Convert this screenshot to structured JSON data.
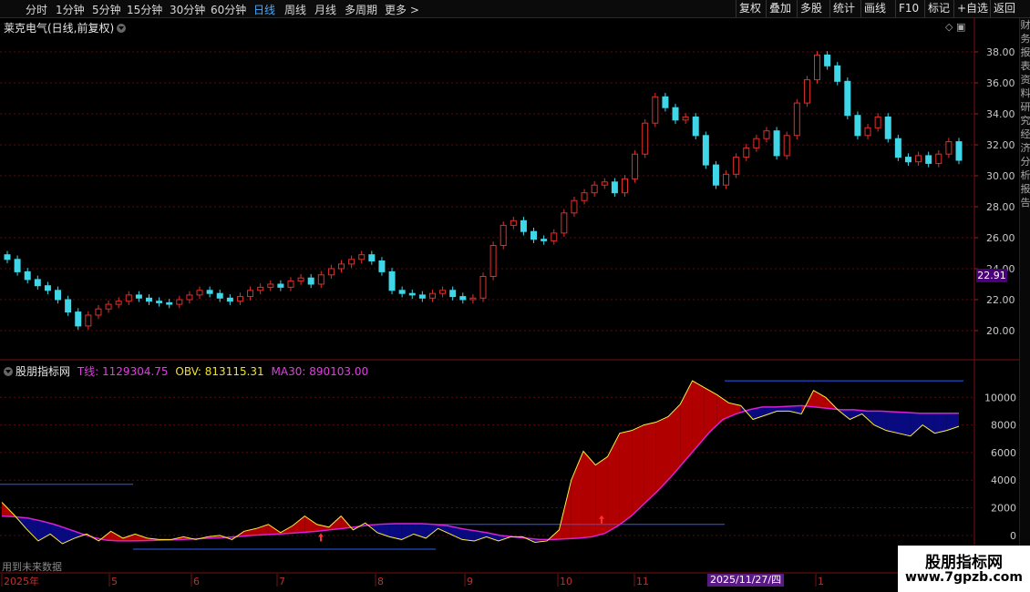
{
  "toolbar": {
    "timeframes": [
      {
        "label": "分时",
        "active": false
      },
      {
        "label": "1分钟",
        "active": false
      },
      {
        "label": "5分钟",
        "active": false
      },
      {
        "label": "15分钟",
        "active": false
      },
      {
        "label": "30分钟",
        "active": false
      },
      {
        "label": "60分钟",
        "active": false
      },
      {
        "label": "日线",
        "active": true
      },
      {
        "label": "周线",
        "active": false
      },
      {
        "label": "月线",
        "active": false
      },
      {
        "label": "多周期",
        "active": false
      },
      {
        "label": "更多 >",
        "active": false
      }
    ],
    "buttons": [
      "复权",
      "叠加",
      "多股",
      "统计",
      "画线",
      "F10",
      "标记",
      "+自选",
      "返回"
    ]
  },
  "main_title": "莱克电气(日线,前复权)",
  "price_axis": [
    "38.00",
    "36.00",
    "34.00",
    "32.00",
    "30.00",
    "28.00",
    "26.00",
    "24.00",
    "22.00",
    "20.00"
  ],
  "current_price": "22.91",
  "indicator": {
    "name": "股朋指标网",
    "t_label": "T线: 1129304.75",
    "obv_label": "OBV: 813115.31",
    "ma_label": "MA30: 890103.00",
    "axis": [
      "10000",
      "8000",
      "6000",
      "4000",
      "2000",
      "0"
    ]
  },
  "time_axis": [
    "2025年",
    "5",
    "6",
    "7",
    "8",
    "9",
    "10",
    "11",
    "1"
  ],
  "highlighted_date": "2025/11/27/四",
  "future_note": "用到未来数据",
  "right_strip": "财务报表资料研究经济分析报告",
  "watermark": {
    "line1": "股朋指标网",
    "line2": "www.7gpzb.com"
  },
  "colors": {
    "up": "#e0302a",
    "down": "#3fd6e8",
    "obv": "#ffee33",
    "ma30": "#d820d8",
    "fill_above": "#b00000",
    "fill_below": "#0a0a80",
    "ref_line": "#2a5cff"
  },
  "chart_data": [
    {
      "type": "candlestick",
      "title": "莱克电气(日线,前复权)",
      "ylim": [
        19,
        39
      ],
      "close_series": [
        24.6,
        23.8,
        23.3,
        22.9,
        22.6,
        22.0,
        21.2,
        20.3,
        21.0,
        21.4,
        21.7,
        21.9,
        22.3,
        22.1,
        21.9,
        21.8,
        21.7,
        22.0,
        22.3,
        22.6,
        22.4,
        22.1,
        21.9,
        22.2,
        22.6,
        22.8,
        23.0,
        22.8,
        23.2,
        23.4,
        23.0,
        23.6,
        24.0,
        24.3,
        24.6,
        24.9,
        24.5,
        23.8,
        22.6,
        22.4,
        22.3,
        22.1,
        22.4,
        22.6,
        22.2,
        22.0,
        22.1,
        23.5,
        25.5,
        26.8,
        27.1,
        26.4,
        25.9,
        25.8,
        26.3,
        27.6,
        28.4,
        28.9,
        29.4,
        29.6,
        28.9,
        29.8,
        31.4,
        33.4,
        35.1,
        34.4,
        33.6,
        33.8,
        32.6,
        30.7,
        29.4,
        30.1,
        31.2,
        31.8,
        32.4,
        32.9,
        31.3,
        32.6,
        34.7,
        36.2,
        37.8,
        37.1,
        36.1,
        33.9,
        32.6,
        33.1,
        33.8,
        32.4,
        31.2,
        30.9,
        31.3,
        30.8,
        31.4,
        32.2,
        31.0
      ],
      "xlabels": [
        "2025年",
        "5",
        "6",
        "7",
        "8",
        "9",
        "10",
        "11",
        "1"
      ]
    },
    {
      "type": "area",
      "title": "股朋指标网",
      "ylim": [
        -800,
        11600
      ],
      "series": [
        {
          "name": "OBV",
          "values": [
            2400,
            1500,
            500,
            -400,
            100,
            -600,
            -200,
            100,
            -400,
            300,
            -200,
            100,
            -200,
            -300,
            -300,
            -100,
            -300,
            -100,
            0,
            -300,
            300,
            500,
            800,
            200,
            700,
            1400,
            800,
            600,
            1400,
            400,
            900,
            200,
            -100,
            -300,
            100,
            -200,
            500,
            100,
            -300,
            -400,
            -100,
            -400,
            -100,
            -100,
            -500,
            -400,
            400,
            4000,
            6100,
            5100,
            5700,
            7400,
            7600,
            8000,
            8200,
            8600,
            9500,
            11200,
            10700,
            10200,
            9600,
            9400,
            8400,
            8700,
            9000,
            9000,
            8800,
            10500,
            10000,
            9100,
            8400,
            8800,
            8000,
            7600,
            7400,
            7200,
            8000,
            7400,
            7600,
            7900
          ]
        },
        {
          "name": "MA30",
          "values": [
            1400,
            1350,
            1250,
            1050,
            800,
            480,
            150,
            -150,
            -350,
            -400,
            -400,
            -380,
            -350,
            -320,
            -280,
            -240,
            -200,
            -150,
            -80,
            0,
            50,
            100,
            160,
            220,
            300,
            400,
            500,
            620,
            750,
            820,
            850,
            850,
            850,
            800,
            700,
            500,
            350,
            200,
            0,
            -100,
            -200,
            -300,
            -300,
            -250,
            -200,
            -100,
            150,
            700,
            1400,
            2300,
            3200,
            4200,
            5300,
            6400,
            7500,
            8400,
            8800,
            9100,
            9300,
            9300,
            9350,
            9400,
            9300,
            9200,
            9100,
            9100,
            9000,
            9000,
            8950,
            8900,
            8850,
            8850,
            8850,
            8850
          ]
        }
      ],
      "xlabels": [
        "2025年",
        "5",
        "6",
        "7",
        "8",
        "9",
        "10",
        "11",
        "1"
      ]
    }
  ]
}
